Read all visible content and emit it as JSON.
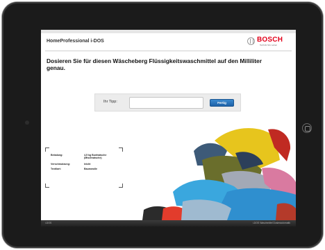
{
  "app": {
    "title": "HomeProfessional i-DOS",
    "brand_name": "BOSCH",
    "brand_tagline": "Technik fürs Leben",
    "brand_color": "#e2001a"
  },
  "main": {
    "headline": "Dosieren Sie für diesen Wäscheberg Flüssigkeitswaschmittel auf den Milliliter genau.",
    "tip_label": "Ihr Tipp:",
    "tip_value": "",
    "tip_placeholder": "",
    "submit_label": "Fertig",
    "accent_color": "#1d62a8"
  },
  "info": {
    "rows": [
      {
        "label": "Beladung:",
        "value": "4,5 kg Buntwäsche (Mischwäsche)"
      },
      {
        "label": "Verschmutzung:",
        "value": "leicht"
      },
      {
        "label": "Textilart:",
        "value": "Baumwolle"
      }
    ]
  },
  "footer": {
    "left_text": "i-DOS",
    "right_text": "i-DOS Waschmittel Dosierautomatik"
  },
  "icons": [
    "camera-icon",
    "home-button-icon",
    "bosch-logo-icon",
    "laundry-image"
  ]
}
